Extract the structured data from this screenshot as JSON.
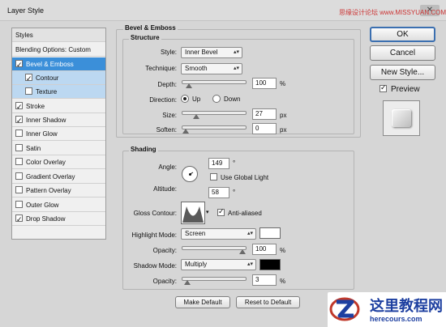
{
  "window": {
    "title": "Layer Style",
    "close_glyph": "✕"
  },
  "watermark_top": "思缘设计论坛 www.MISSYUAN.COM",
  "styles_panel": {
    "header": "Styles",
    "items": [
      {
        "label": "Blending Options: Custom",
        "checked": null,
        "state": "normal"
      },
      {
        "label": "Bevel & Emboss",
        "checked": true,
        "state": "active"
      },
      {
        "label": "Contour",
        "checked": true,
        "state": "sub"
      },
      {
        "label": "Texture",
        "checked": false,
        "state": "sub"
      },
      {
        "label": "Stroke",
        "checked": true,
        "state": "normal"
      },
      {
        "label": "Inner Shadow",
        "checked": true,
        "state": "normal"
      },
      {
        "label": "Inner Glow",
        "checked": false,
        "state": "normal"
      },
      {
        "label": "Satin",
        "checked": false,
        "state": "normal"
      },
      {
        "label": "Color Overlay",
        "checked": false,
        "state": "normal"
      },
      {
        "label": "Gradient Overlay",
        "checked": false,
        "state": "normal"
      },
      {
        "label": "Pattern Overlay",
        "checked": false,
        "state": "normal"
      },
      {
        "label": "Outer Glow",
        "checked": false,
        "state": "normal"
      },
      {
        "label": "Drop Shadow",
        "checked": true,
        "state": "normal"
      }
    ]
  },
  "bevel": {
    "title": "Bevel & Emboss",
    "structure_title": "Structure",
    "style_label": "Style:",
    "style_value": "Inner Bevel",
    "technique_label": "Technique:",
    "technique_value": "Smooth",
    "depth_label": "Depth:",
    "depth_value": "100",
    "depth_unit": "%",
    "depth_level": 0.05,
    "direction_label": "Direction:",
    "direction_up": "Up",
    "direction_down": "Down",
    "direction_selected": "Up",
    "size_label": "Size:",
    "size_value": "27",
    "size_unit": "px",
    "size_level": 0.18,
    "soften_label": "Soften:",
    "soften_value": "0",
    "soften_unit": "px",
    "soften_level": 0.0
  },
  "shading": {
    "title": "Shading",
    "angle_label": "Angle:",
    "angle_value": "149",
    "angle_unit": "°",
    "global_light_label": "Use Global Light",
    "global_light_checked": false,
    "altitude_label": "Altitude:",
    "altitude_value": "58",
    "altitude_unit": "°",
    "gloss_label": "Gloss Contour:",
    "anti_aliased_label": "Anti-aliased",
    "anti_aliased_checked": true,
    "highlight_mode_label": "Highlight Mode:",
    "highlight_mode_value": "Screen",
    "highlight_color": "#ffffff",
    "highlight_opacity_label": "Opacity:",
    "highlight_opacity_value": "100",
    "highlight_opacity_unit": "%",
    "highlight_opacity_level": 1.0,
    "shadow_mode_label": "Shadow Mode:",
    "shadow_mode_value": "Multiply",
    "shadow_color": "#000000",
    "shadow_opacity_label": "Opacity:",
    "shadow_opacity_value": "3",
    "shadow_opacity_unit": "%",
    "shadow_opacity_level": 0.03
  },
  "footer": {
    "make_default": "Make Default",
    "reset_default": "Reset to Default"
  },
  "right": {
    "ok": "OK",
    "cancel": "Cancel",
    "new_style": "New Style...",
    "preview_label": "Preview",
    "preview_checked": true
  },
  "logo": {
    "text": "这里教程网",
    "url": "herecours.com"
  },
  "colors": {
    "accent": "#3b8fd9",
    "sub_bg": "#bcd8f1",
    "logo_blue": "#1d3fa0"
  }
}
